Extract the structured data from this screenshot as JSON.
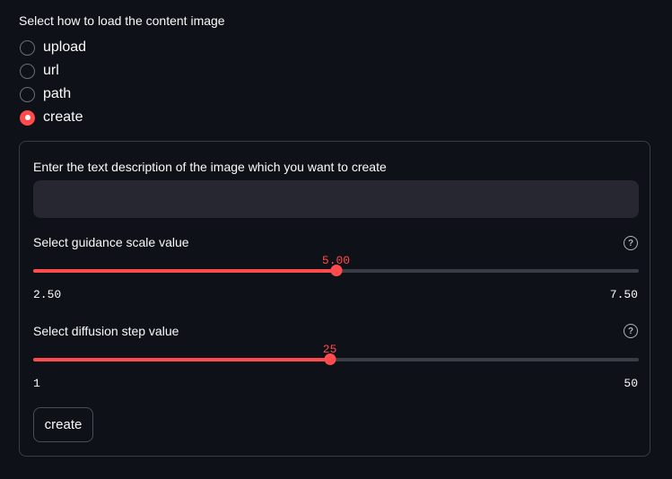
{
  "load_source": {
    "label": "Select how to load the content image",
    "options": [
      "upload",
      "url",
      "path",
      "create"
    ],
    "selected": "create"
  },
  "form": {
    "description_label": "Enter the text description of the image which you want to create",
    "description_value": "",
    "guidance": {
      "label": "Select guidance scale value",
      "value": 5.0,
      "value_text": "5.00",
      "min": 2.5,
      "max": 7.5,
      "min_text": "2.50",
      "max_text": "7.50"
    },
    "diffusion": {
      "label": "Select diffusion step value",
      "value": 25,
      "value_text": "25",
      "min": 1,
      "max": 50,
      "min_text": "1",
      "max_text": "50"
    },
    "help_glyph": "?",
    "create_button": "create"
  },
  "colors": {
    "accent": "#ff4b4b",
    "background": "#0e1117",
    "input_bg": "#262730",
    "border": "#3a3d45"
  },
  "icons": {
    "help": "question-circle-icon"
  }
}
